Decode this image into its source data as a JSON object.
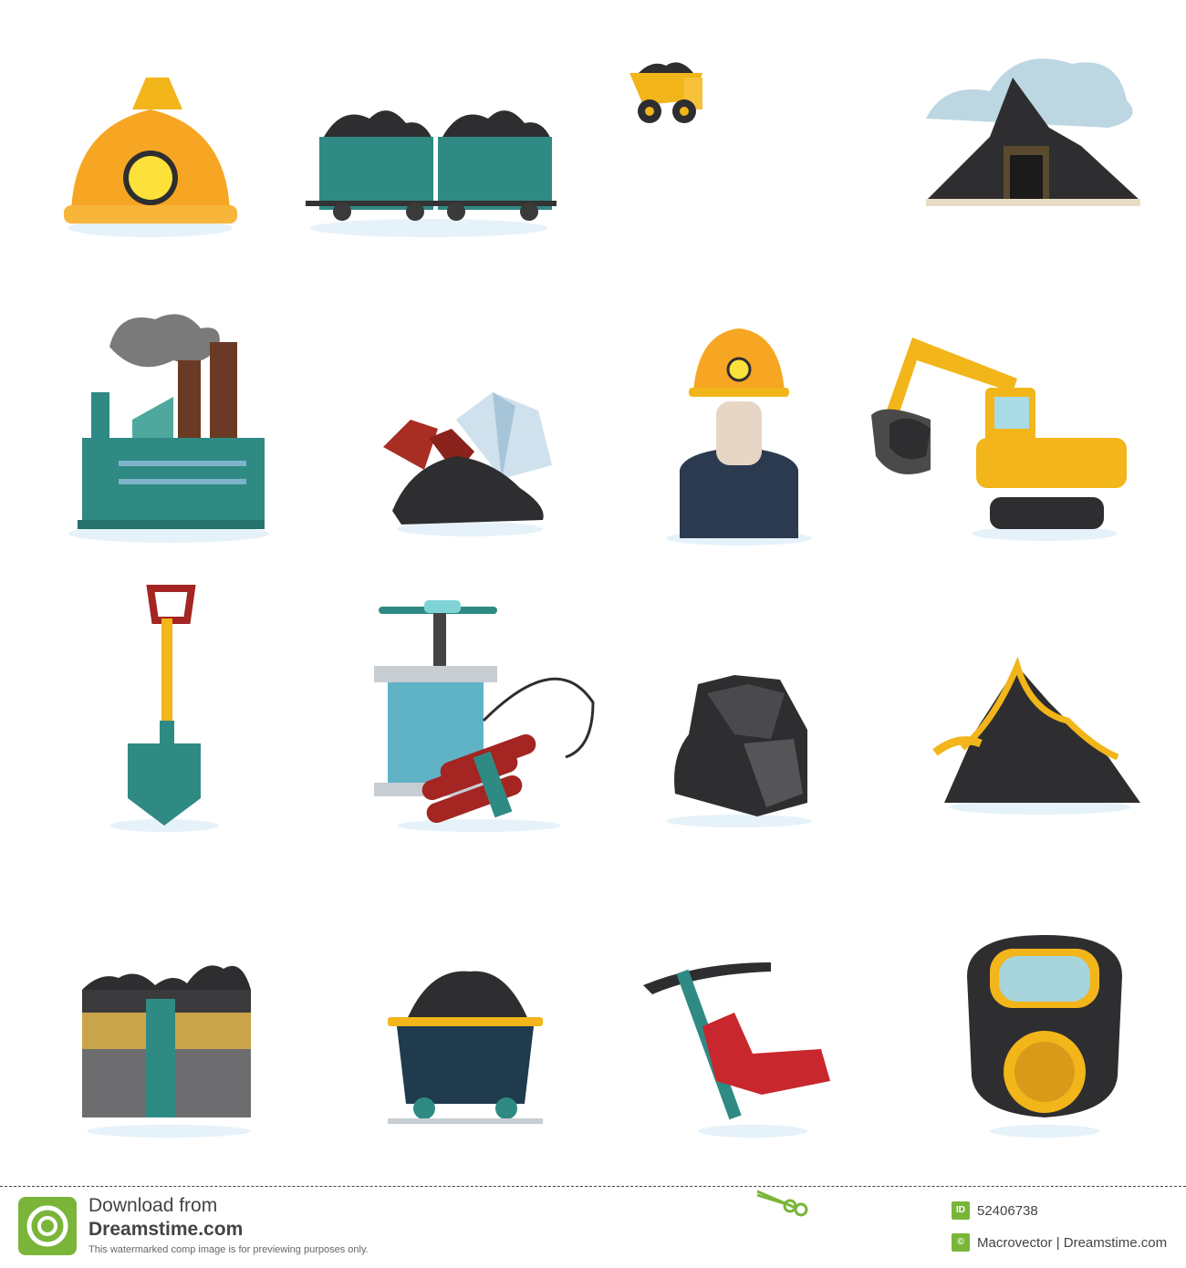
{
  "icons": [
    {
      "name": "mining-helmet-icon"
    },
    {
      "name": "coal-train-icon"
    },
    {
      "name": "dump-truck-icon"
    },
    {
      "name": "mine-entrance-icon"
    },
    {
      "name": "factory-icon"
    },
    {
      "name": "gems-icon"
    },
    {
      "name": "miner-icon"
    },
    {
      "name": "excavator-icon"
    },
    {
      "name": "shovel-icon"
    },
    {
      "name": "detonator-dynamite-icon"
    },
    {
      "name": "coal-lump-icon"
    },
    {
      "name": "gold-ore-icon"
    },
    {
      "name": "coal-seam-icon"
    },
    {
      "name": "mine-cart-icon"
    },
    {
      "name": "pickaxe-icon"
    },
    {
      "name": "gas-mask-icon"
    }
  ],
  "colors": {
    "helmet": "#f7a623",
    "teal": "#2f8a84",
    "coal": "#2e2e30",
    "gold": "#f2b51a",
    "brick": "#6b3a24"
  },
  "footer": {
    "line1": "Download from",
    "line2": "Dreamstime.com",
    "line3": "This watermarked comp image is for previewing purposes only.",
    "id_badge": "ID",
    "image_id": "52406738",
    "copy_badge": "©",
    "credit": "Macrovector | Dreamstime.com"
  }
}
